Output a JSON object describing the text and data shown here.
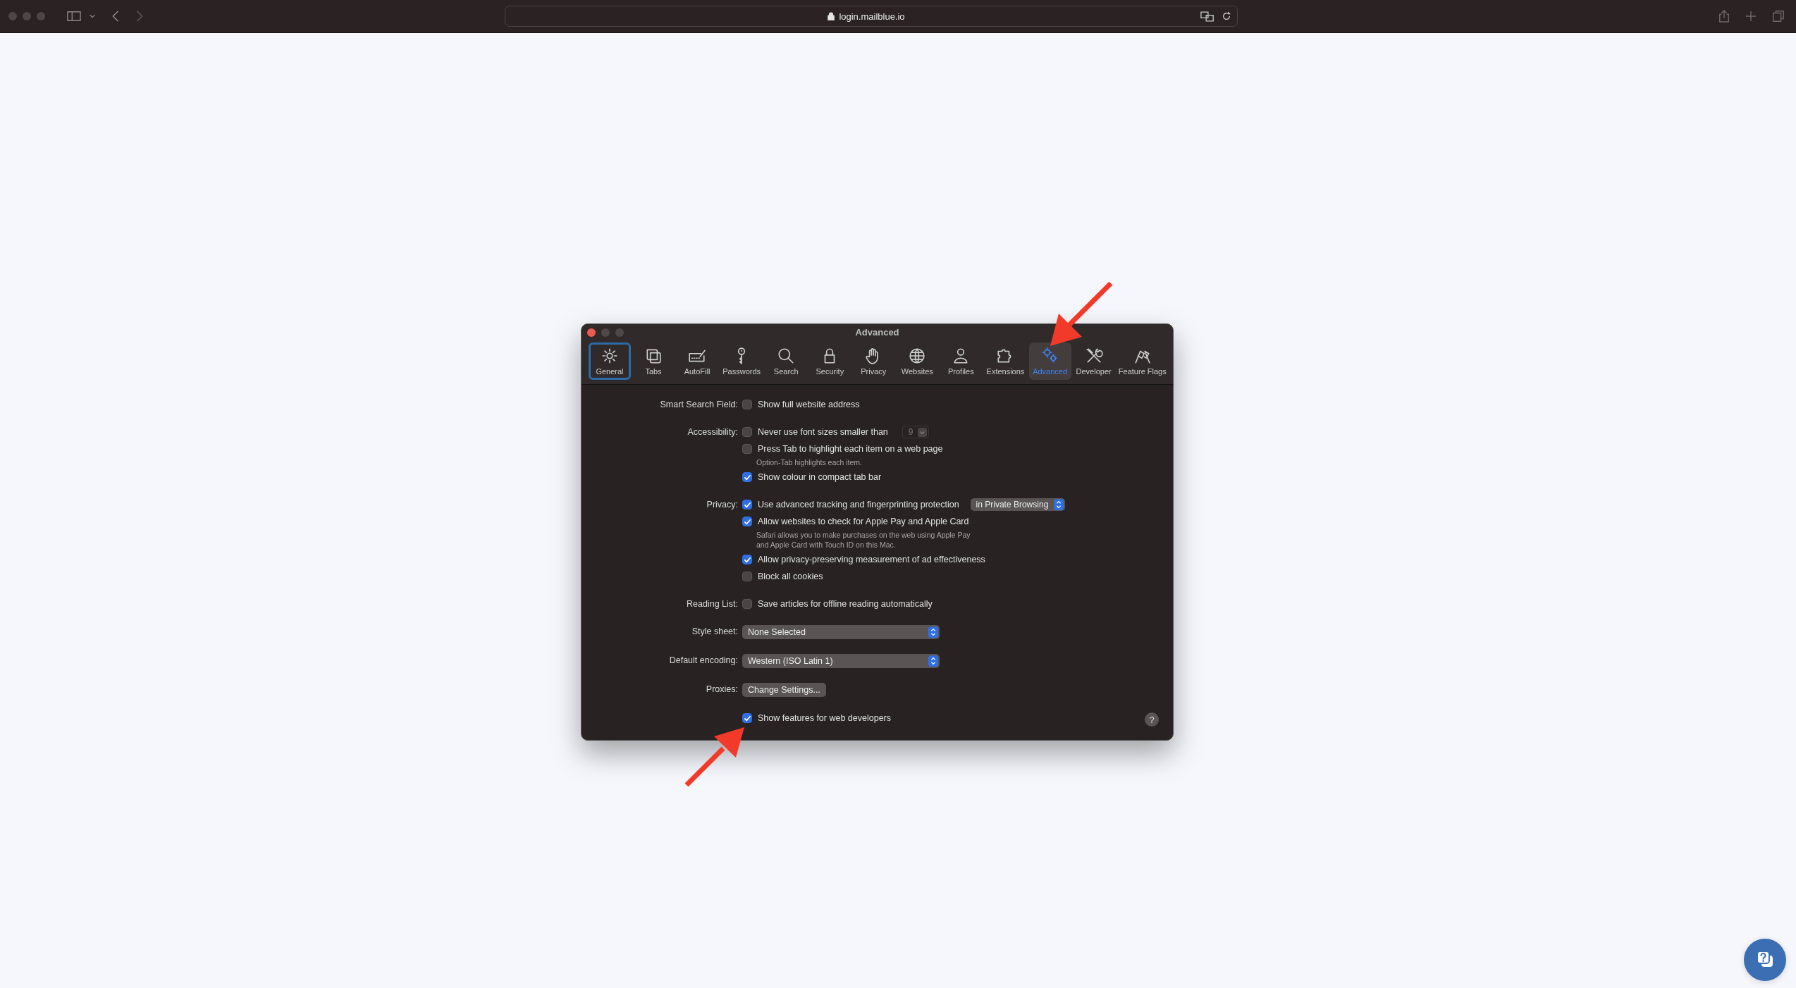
{
  "browser": {
    "url": "login.mailblue.io"
  },
  "dialog": {
    "title": "Advanced",
    "tabs": [
      {
        "label": "General",
        "selected": false,
        "focused": true
      },
      {
        "label": "Tabs",
        "selected": false,
        "focused": false
      },
      {
        "label": "AutoFill",
        "selected": false,
        "focused": false
      },
      {
        "label": "Passwords",
        "selected": false,
        "focused": false
      },
      {
        "label": "Search",
        "selected": false,
        "focused": false
      },
      {
        "label": "Security",
        "selected": false,
        "focused": false
      },
      {
        "label": "Privacy",
        "selected": false,
        "focused": false
      },
      {
        "label": "Websites",
        "selected": false,
        "focused": false
      },
      {
        "label": "Profiles",
        "selected": false,
        "focused": false
      },
      {
        "label": "Extensions",
        "selected": false,
        "focused": false
      },
      {
        "label": "Advanced",
        "selected": true,
        "focused": false
      },
      {
        "label": "Developer",
        "selected": false,
        "focused": false
      },
      {
        "label": "Feature Flags",
        "selected": false,
        "focused": false
      }
    ],
    "sections": [
      {
        "label": "Smart Search Field:",
        "items": [
          {
            "kind": "checkbox",
            "label": "Show full website address",
            "checked": false
          }
        ]
      },
      {
        "label": "Accessibility:",
        "items": [
          {
            "kind": "checkbox",
            "label": "Never use font sizes smaller than",
            "checked": false,
            "control": {
              "kind": "stepper",
              "value": "9",
              "disabled": true
            }
          },
          {
            "kind": "checkbox",
            "label": "Press Tab to highlight each item on a web page",
            "checked": false
          },
          {
            "kind": "note",
            "text": "Option-Tab highlights each item."
          },
          {
            "kind": "checkbox",
            "label": "Show colour in compact tab bar",
            "checked": true
          }
        ]
      },
      {
        "label": "Privacy:",
        "items": [
          {
            "kind": "checkbox",
            "label": "Use advanced tracking and fingerprinting protection",
            "checked": true,
            "control": {
              "kind": "popup",
              "value": "in Private Browsing",
              "disabled": false
            }
          },
          {
            "kind": "checkbox",
            "label": "Allow websites to check for Apple Pay and Apple Card",
            "checked": true
          },
          {
            "kind": "note",
            "text": "Safari allows you to make purchases on the web using Apple Pay\nand Apple Card with Touch ID on this Mac."
          },
          {
            "kind": "checkbox",
            "label": "Allow privacy-preserving measurement of ad effectiveness",
            "checked": true
          },
          {
            "kind": "checkbox",
            "label": "Block all cookies",
            "checked": false
          }
        ]
      },
      {
        "label": "Reading List:",
        "items": [
          {
            "kind": "checkbox",
            "label": "Save articles for offline reading automatically",
            "checked": false
          }
        ]
      },
      {
        "label": "Style sheet:",
        "items": [
          {
            "kind": "popup",
            "value": "None Selected"
          }
        ]
      },
      {
        "label": "Default encoding:",
        "items": [
          {
            "kind": "popup",
            "value": "Western (ISO Latin 1)"
          }
        ]
      },
      {
        "label": "Proxies:",
        "items": [
          {
            "kind": "button",
            "label": "Change Settings..."
          }
        ]
      },
      {
        "items": [
          {
            "kind": "checkbox",
            "label": "Show features for web developers",
            "checked": true
          }
        ]
      }
    ],
    "help_button": "?"
  }
}
